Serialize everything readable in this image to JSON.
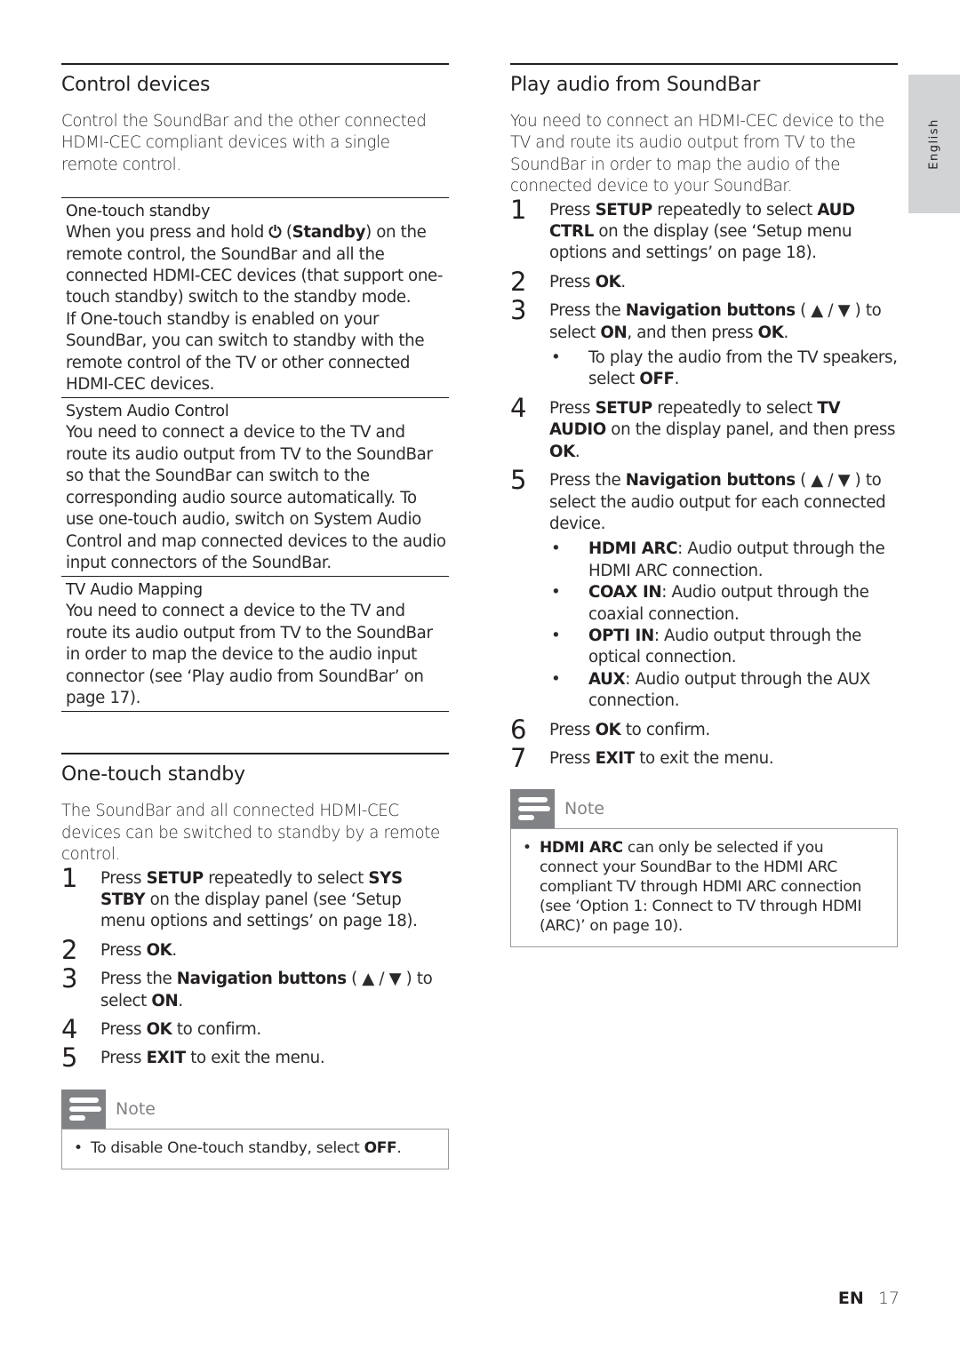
{
  "side_tab": {
    "label": "English"
  },
  "footer": {
    "lang": "EN",
    "page": "17"
  },
  "left": {
    "control_devices": {
      "title": "Control devices",
      "intro": "Control the SoundBar and the other connected HDMI-CEC compliant devices with a single remote control.",
      "rows": [
        {
          "title": "One-touch standby",
          "text_a": "When you press and hold ",
          "icon": "⏻",
          "text_b": " (",
          "bold": "Standby",
          "text_c": ") on the remote control, the SoundBar and all the connected HDMI-CEC devices (that support one-touch standby) switch to the standby mode.",
          "text_d": "If One-touch standby is enabled on your SoundBar, you can switch to standby with the remote control of the TV or other connected HDMI-CEC devices."
        },
        {
          "title": "System Audio Control",
          "text": "You need to connect a device to the TV and route its audio output from TV to the SoundBar so that the SoundBar can switch to the corresponding audio source automatically. To use one-touch audio, switch on System Audio Control and map connected devices to the audio input connectors of the SoundBar."
        },
        {
          "title": "TV Audio Mapping",
          "text": "You need to connect a device to the TV and route its audio output from TV to the SoundBar in order to map the device to the audio input connector (see ‘Play audio from SoundBar’ on page 17)."
        }
      ]
    },
    "one_touch": {
      "title": "One-touch standby",
      "intro": "The SoundBar and all connected HDMI-CEC devices can be switched to standby by a remote control.",
      "steps": [
        {
          "num": "1",
          "parts": [
            "Press ",
            "SETUP",
            " repeatedly to select ",
            "SYS STBY",
            " on the display panel (see ‘Setup menu options and settings’ on page 18)."
          ]
        },
        {
          "num": "2",
          "parts": [
            "Press ",
            "OK",
            "."
          ]
        },
        {
          "num": "3",
          "parts": [
            "Press the ",
            "Navigation buttons",
            " ( ▲ / ▼ ) to select ",
            "ON",
            "."
          ]
        },
        {
          "num": "4",
          "parts": [
            "Press ",
            "OK",
            " to confirm."
          ]
        },
        {
          "num": "5",
          "parts": [
            "Press ",
            "EXIT",
            " to exit the menu."
          ]
        }
      ],
      "note": {
        "label": "Note",
        "items": [
          {
            "parts": [
              "To disable One-touch standby, select ",
              "OFF",
              "."
            ]
          }
        ]
      }
    }
  },
  "right": {
    "play_audio": {
      "title": "Play audio from SoundBar",
      "intro": "You need to connect an HDMI-CEC device to the TV and route its audio output from TV to the SoundBar in order to map the audio of the connected device to your SoundBar.",
      "steps": [
        {
          "num": "1",
          "parts": [
            "Press ",
            "SETUP",
            " repeatedly to select ",
            "AUD CTRL",
            " on the display (see ‘Setup menu options and settings’ on page 18)."
          ]
        },
        {
          "num": "2",
          "parts": [
            "Press ",
            "OK",
            "."
          ]
        },
        {
          "num": "3",
          "parts": [
            "Press the ",
            "Navigation buttons",
            " ( ▲ / ▼ ) to select ",
            "ON",
            ", and then press ",
            "OK",
            "."
          ],
          "bullets": [
            {
              "parts": [
                "To play the audio from the TV speakers, select ",
                "OFF",
                "."
              ]
            }
          ]
        },
        {
          "num": "4",
          "parts": [
            "Press ",
            "SETUP",
            " repeatedly to select ",
            "TV AUDIO",
            " on the display panel, and then press ",
            "OK",
            "."
          ]
        },
        {
          "num": "5",
          "parts": [
            "Press the ",
            "Navigation buttons",
            " ( ▲ / ▼ ) to select the audio output for each connected device."
          ],
          "bullets": [
            {
              "parts": [
                "",
                "HDMI ARC",
                ": Audio output through the HDMI ARC connection."
              ]
            },
            {
              "parts": [
                "",
                "COAX IN",
                ": Audio output through the coaxial connection."
              ]
            },
            {
              "parts": [
                "",
                "OPTI IN",
                ": Audio output through the optical connection."
              ]
            },
            {
              "parts": [
                "",
                "AUX",
                ": Audio output through the AUX connection."
              ]
            }
          ]
        },
        {
          "num": "6",
          "parts": [
            "Press ",
            "OK",
            " to confirm."
          ]
        },
        {
          "num": "7",
          "parts": [
            "Press ",
            "EXIT",
            " to exit the menu."
          ]
        }
      ],
      "note": {
        "label": "Note",
        "items": [
          {
            "parts": [
              "",
              "HDMI ARC",
              " can only be selected if you connect your SoundBar to the HDMI ARC compliant TV through HDMI ARC connection (see ‘Option 1: Connect to TV through HDMI (ARC)’ on page 10)."
            ]
          }
        ]
      }
    }
  }
}
